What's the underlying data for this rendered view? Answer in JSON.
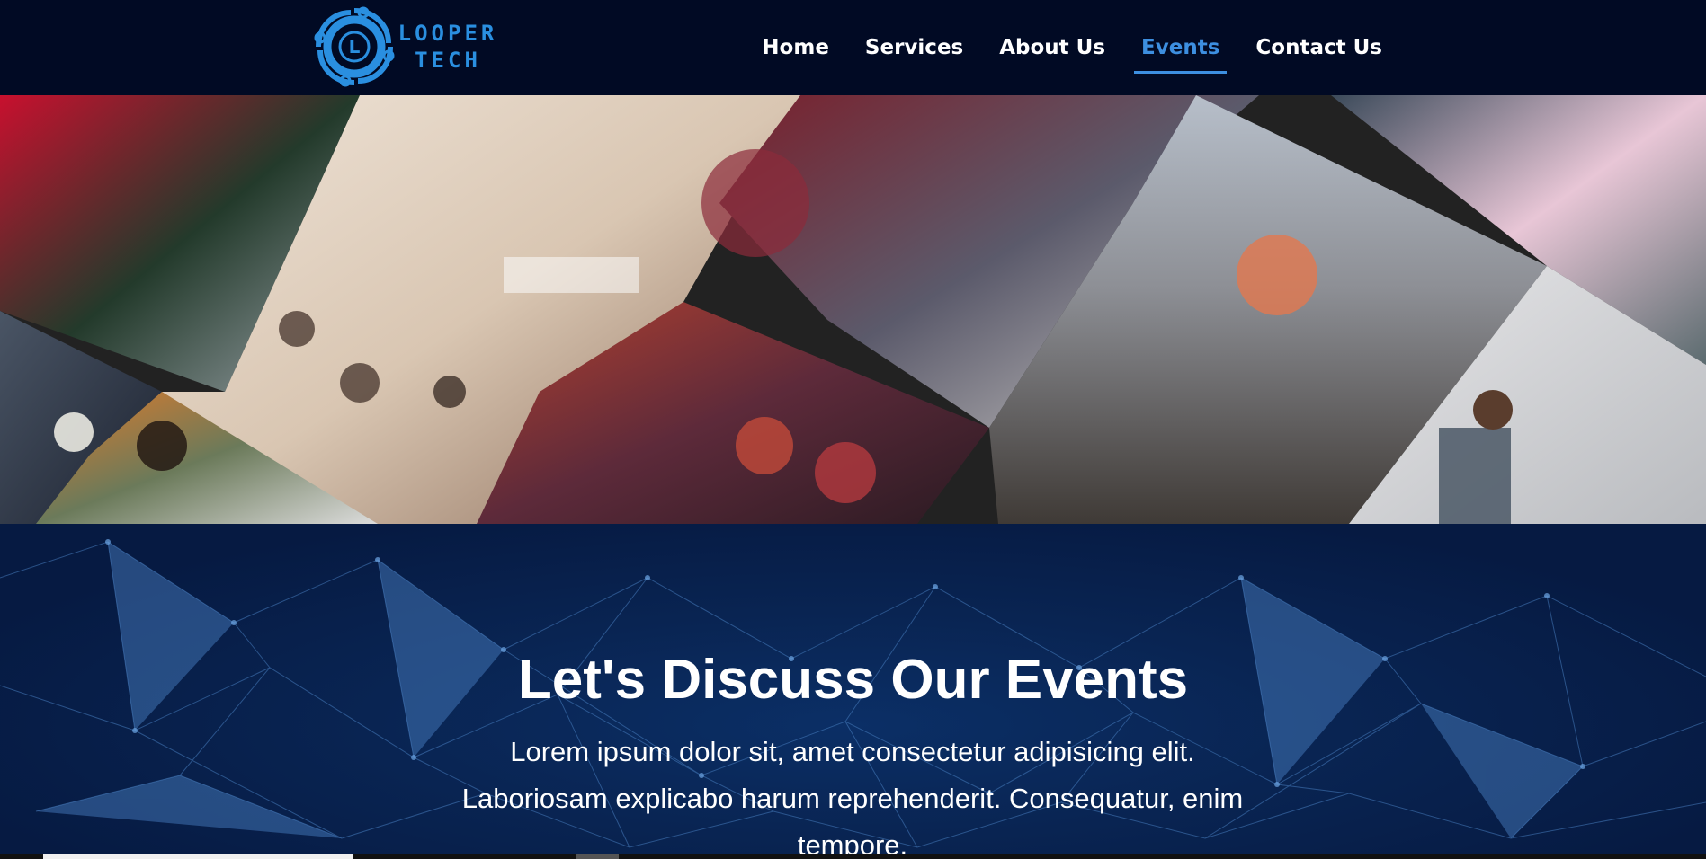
{
  "brand": {
    "line1": "LOOPER",
    "line2": "TECH",
    "mark_letter": "L",
    "color": "#2a8fe0"
  },
  "nav": {
    "items": [
      {
        "label": "Home",
        "active": false
      },
      {
        "label": "Services",
        "active": false
      },
      {
        "label": "About Us",
        "active": false
      },
      {
        "label": "Events",
        "active": true
      },
      {
        "label": "Contact Us",
        "active": false
      }
    ],
    "active_color": "#3d8fe0"
  },
  "collage": {
    "photos": [
      "group-portrait-photo",
      "yoga-session-photo",
      "seminar-audience-photo",
      "ganesha-idol-photo",
      "conference-hall-photo",
      "garba-dancers-photo",
      "friends-outdoor-photo",
      "speaker-photo"
    ]
  },
  "hero": {
    "title": "Let's Discuss Our Events",
    "text": "Lorem ipsum dolor sit, amet consectetur adipisicing elit. Laboriosam explicabo harum reprehenderit. Consequatur, enim tempore."
  }
}
